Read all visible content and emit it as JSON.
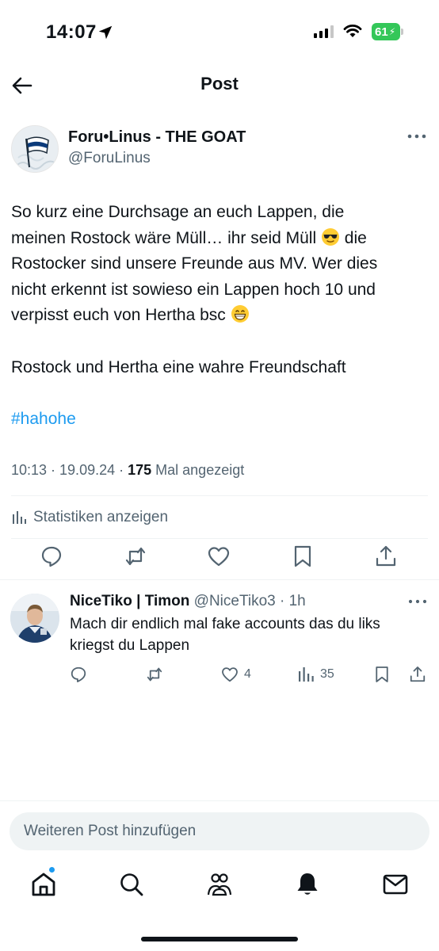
{
  "status_bar": {
    "time": "14:07",
    "battery": "61"
  },
  "header": {
    "title": "Post"
  },
  "post": {
    "author_name": "Foru•Linus - THE GOAT",
    "author_handle": "@ForuLinus",
    "line1": "So kurz eine Durchsage an euch Lappen, die",
    "line2a": "meinen Rostock wäre Müll… ihr seid Müll ",
    "line2b": " die",
    "line3": "Rostocker sind unsere Freunde aus MV. Wer dies",
    "line4": "nicht erkennt ist sowieso ein Lappen hoch 10 und",
    "line5": "verpisst euch von Hertha bsc ",
    "line6": "Rostock und Hertha eine wahre Freundschaft",
    "hashtag": "#hahohe",
    "time_date": "10:13 · 19.09.24 · ",
    "views_count": "175",
    "views_label": " Mal angezeigt",
    "stats_label": "Statistiken anzeigen",
    "emoji_1": "sunglasses-emoji",
    "emoji_2": "grinning-emoji"
  },
  "reply": {
    "name": "NiceTiko | Timon",
    "handle": " @NiceTiko3 · 1h",
    "text": "Mach dir endlich mal fake accounts das du liks kriegst du Lappen",
    "likes": "4",
    "views": "35"
  },
  "composer": {
    "placeholder": "Weiteren Post hinzufügen"
  },
  "colors": {
    "accent": "#1d9bf0",
    "secondary_text": "#536471",
    "battery": "#34c759"
  }
}
